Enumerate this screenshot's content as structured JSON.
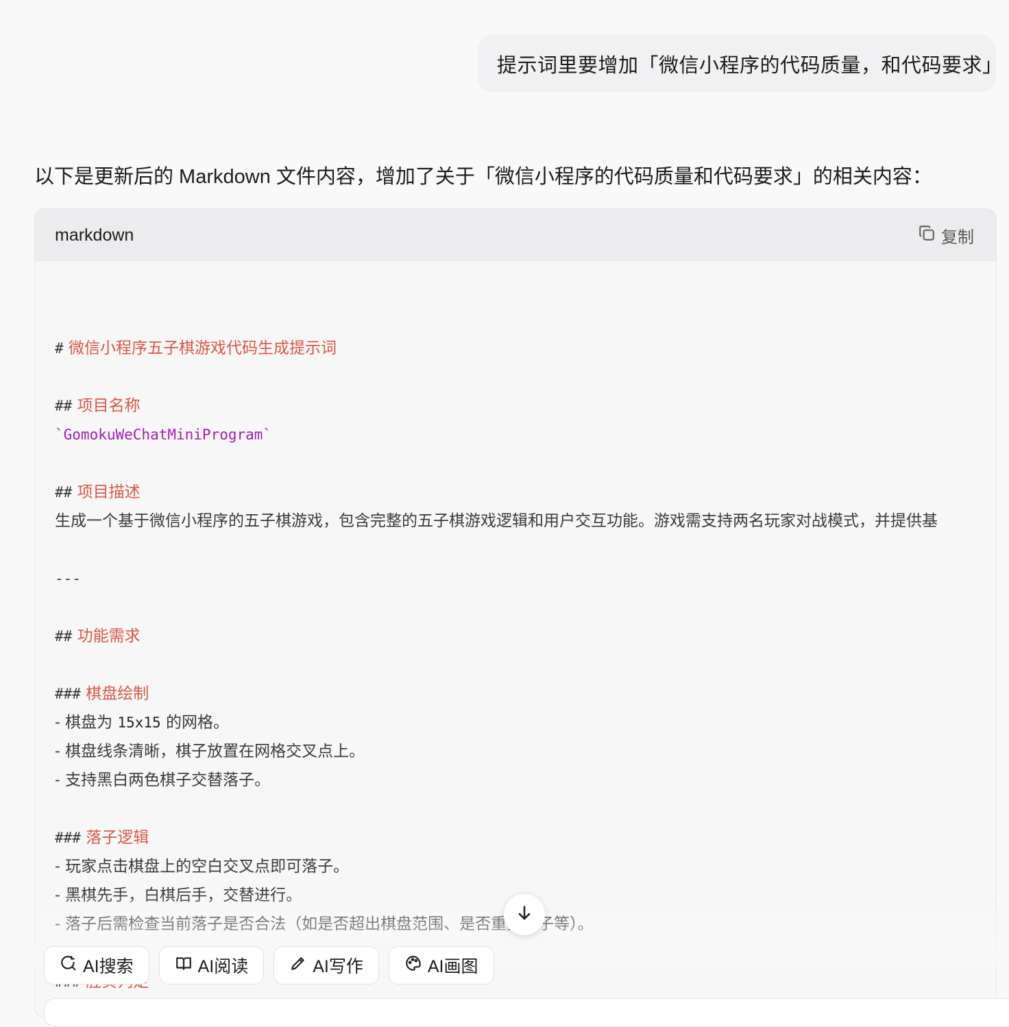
{
  "user_message": "提示词里要增加「微信小程序的代码质量，和代码要求」",
  "assistant_intro": "以下是更新后的 Markdown 文件内容，增加了关于「微信小程序的代码质量和代码要求」的相关内容：",
  "code_block": {
    "language": "markdown",
    "copy_label": "复制",
    "lines": {
      "l1_mark": "#",
      "l1_text": "微信小程序五子棋游戏代码生成提示词",
      "l2_mark": "##",
      "l2_text": "项目名称",
      "l3_code": "`GomokuWeChatMiniProgram`",
      "l4_mark": "##",
      "l4_text": "项目描述",
      "l5_text": "生成一个基于微信小程序的五子棋游戏，包含完整的五子棋游戏逻辑和用户交互功能。游戏需支持两名玩家对战模式，并提供基",
      "l6_rule": "---",
      "l7_mark": "##",
      "l7_text": "功能需求",
      "l8_mark": "###",
      "l8_text": "棋盘绘制",
      "l9_a": "- 棋盘为",
      "l9_b": "15x15",
      "l9_c": "的网格。",
      "l10_text": "- 棋盘线条清晰，棋子放置在网格交叉点上。",
      "l11_text": "- 支持黑白两色棋子交替落子。",
      "l12_mark": "###",
      "l12_text": "落子逻辑",
      "l13_text": "- 玩家点击棋盘上的空白交叉点即可落子。",
      "l14_text": "- 黑棋先手，白棋后手，交替进行。",
      "l15_text": "- 落子后需检查当前落子是否合法（如是否超出棋盘范围、是否重复落子等）。",
      "l16_mark": "###",
      "l16_text": "胜负判定"
    }
  },
  "toolbar": {
    "search_label": "AI搜索",
    "read_label": "AI阅读",
    "write_label": "AI写作",
    "draw_label": "AI画图"
  }
}
